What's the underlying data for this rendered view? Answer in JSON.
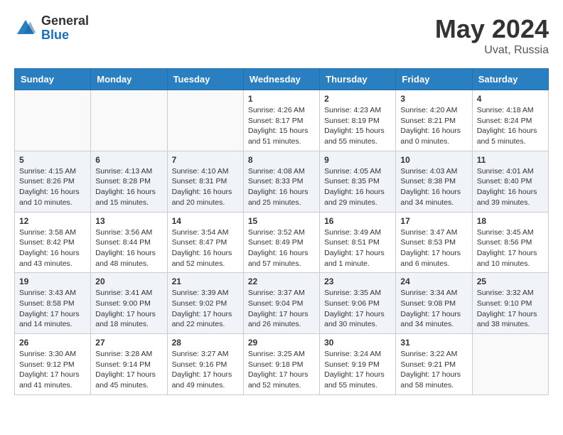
{
  "header": {
    "logo_general": "General",
    "logo_blue": "Blue",
    "month_year": "May 2024",
    "location": "Uvat, Russia"
  },
  "days_of_week": [
    "Sunday",
    "Monday",
    "Tuesday",
    "Wednesday",
    "Thursday",
    "Friday",
    "Saturday"
  ],
  "weeks": [
    [
      {
        "day": "",
        "info": ""
      },
      {
        "day": "",
        "info": ""
      },
      {
        "day": "",
        "info": ""
      },
      {
        "day": "1",
        "info": "Sunrise: 4:26 AM\nSunset: 8:17 PM\nDaylight: 15 hours and 51 minutes."
      },
      {
        "day": "2",
        "info": "Sunrise: 4:23 AM\nSunset: 8:19 PM\nDaylight: 15 hours and 55 minutes."
      },
      {
        "day": "3",
        "info": "Sunrise: 4:20 AM\nSunset: 8:21 PM\nDaylight: 16 hours and 0 minutes."
      },
      {
        "day": "4",
        "info": "Sunrise: 4:18 AM\nSunset: 8:24 PM\nDaylight: 16 hours and 5 minutes."
      }
    ],
    [
      {
        "day": "5",
        "info": "Sunrise: 4:15 AM\nSunset: 8:26 PM\nDaylight: 16 hours and 10 minutes."
      },
      {
        "day": "6",
        "info": "Sunrise: 4:13 AM\nSunset: 8:28 PM\nDaylight: 16 hours and 15 minutes."
      },
      {
        "day": "7",
        "info": "Sunrise: 4:10 AM\nSunset: 8:31 PM\nDaylight: 16 hours and 20 minutes."
      },
      {
        "day": "8",
        "info": "Sunrise: 4:08 AM\nSunset: 8:33 PM\nDaylight: 16 hours and 25 minutes."
      },
      {
        "day": "9",
        "info": "Sunrise: 4:05 AM\nSunset: 8:35 PM\nDaylight: 16 hours and 29 minutes."
      },
      {
        "day": "10",
        "info": "Sunrise: 4:03 AM\nSunset: 8:38 PM\nDaylight: 16 hours and 34 minutes."
      },
      {
        "day": "11",
        "info": "Sunrise: 4:01 AM\nSunset: 8:40 PM\nDaylight: 16 hours and 39 minutes."
      }
    ],
    [
      {
        "day": "12",
        "info": "Sunrise: 3:58 AM\nSunset: 8:42 PM\nDaylight: 16 hours and 43 minutes."
      },
      {
        "day": "13",
        "info": "Sunrise: 3:56 AM\nSunset: 8:44 PM\nDaylight: 16 hours and 48 minutes."
      },
      {
        "day": "14",
        "info": "Sunrise: 3:54 AM\nSunset: 8:47 PM\nDaylight: 16 hours and 52 minutes."
      },
      {
        "day": "15",
        "info": "Sunrise: 3:52 AM\nSunset: 8:49 PM\nDaylight: 16 hours and 57 minutes."
      },
      {
        "day": "16",
        "info": "Sunrise: 3:49 AM\nSunset: 8:51 PM\nDaylight: 17 hours and 1 minute."
      },
      {
        "day": "17",
        "info": "Sunrise: 3:47 AM\nSunset: 8:53 PM\nDaylight: 17 hours and 6 minutes."
      },
      {
        "day": "18",
        "info": "Sunrise: 3:45 AM\nSunset: 8:56 PM\nDaylight: 17 hours and 10 minutes."
      }
    ],
    [
      {
        "day": "19",
        "info": "Sunrise: 3:43 AM\nSunset: 8:58 PM\nDaylight: 17 hours and 14 minutes."
      },
      {
        "day": "20",
        "info": "Sunrise: 3:41 AM\nSunset: 9:00 PM\nDaylight: 17 hours and 18 minutes."
      },
      {
        "day": "21",
        "info": "Sunrise: 3:39 AM\nSunset: 9:02 PM\nDaylight: 17 hours and 22 minutes."
      },
      {
        "day": "22",
        "info": "Sunrise: 3:37 AM\nSunset: 9:04 PM\nDaylight: 17 hours and 26 minutes."
      },
      {
        "day": "23",
        "info": "Sunrise: 3:35 AM\nSunset: 9:06 PM\nDaylight: 17 hours and 30 minutes."
      },
      {
        "day": "24",
        "info": "Sunrise: 3:34 AM\nSunset: 9:08 PM\nDaylight: 17 hours and 34 minutes."
      },
      {
        "day": "25",
        "info": "Sunrise: 3:32 AM\nSunset: 9:10 PM\nDaylight: 17 hours and 38 minutes."
      }
    ],
    [
      {
        "day": "26",
        "info": "Sunrise: 3:30 AM\nSunset: 9:12 PM\nDaylight: 17 hours and 41 minutes."
      },
      {
        "day": "27",
        "info": "Sunrise: 3:28 AM\nSunset: 9:14 PM\nDaylight: 17 hours and 45 minutes."
      },
      {
        "day": "28",
        "info": "Sunrise: 3:27 AM\nSunset: 9:16 PM\nDaylight: 17 hours and 49 minutes."
      },
      {
        "day": "29",
        "info": "Sunrise: 3:25 AM\nSunset: 9:18 PM\nDaylight: 17 hours and 52 minutes."
      },
      {
        "day": "30",
        "info": "Sunrise: 3:24 AM\nSunset: 9:19 PM\nDaylight: 17 hours and 55 minutes."
      },
      {
        "day": "31",
        "info": "Sunrise: 3:22 AM\nSunset: 9:21 PM\nDaylight: 17 hours and 58 minutes."
      },
      {
        "day": "",
        "info": ""
      }
    ]
  ]
}
